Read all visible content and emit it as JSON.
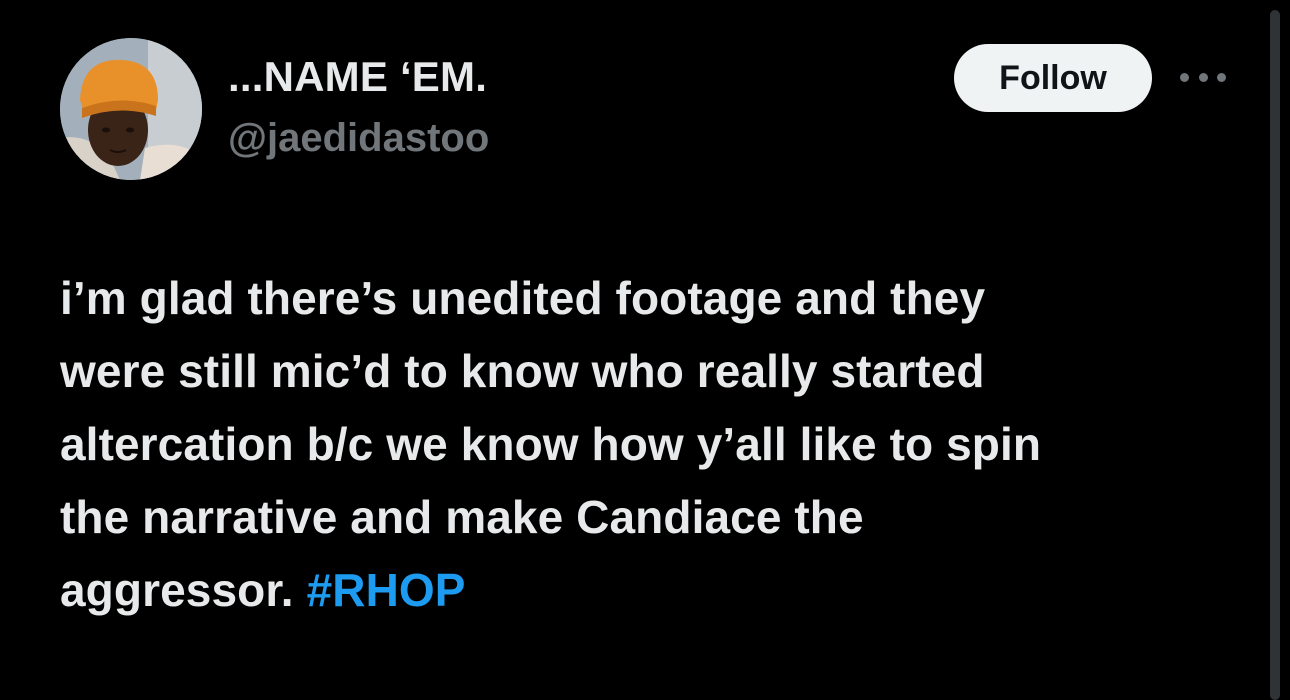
{
  "author": {
    "display_name": "...NAME ‘EM.",
    "handle": "@jaedidastoo",
    "avatar_icon": "profile-photo"
  },
  "actions": {
    "follow_label": "Follow",
    "more_icon": "more-horizontal-icon"
  },
  "tweet": {
    "lines": [
      "i’m glad there’s unedited footage and they",
      "were still mic’d to know who really started",
      "altercation b/c we know how y’all like to spin",
      "the narrative and make Candiace the"
    ],
    "last_line_text": "aggressor. ",
    "hashtag": "#RHOP"
  },
  "colors": {
    "background": "#000000",
    "text_primary": "#e7e9ea",
    "text_secondary": "#71767b",
    "link": "#1d9bf0",
    "follow_bg": "#eff3f4"
  }
}
